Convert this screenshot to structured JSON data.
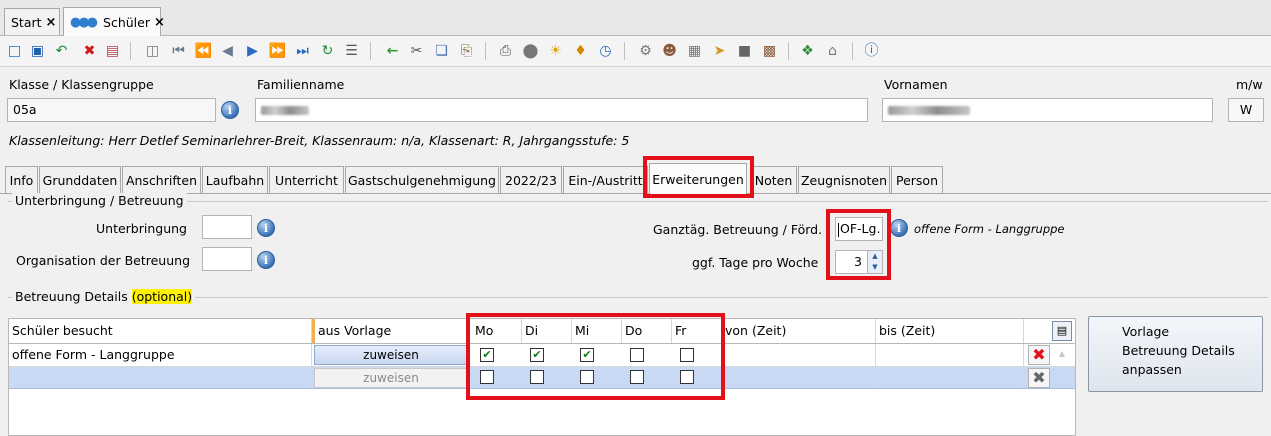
{
  "doc_tabs": [
    {
      "label": "Start",
      "close": "×"
    },
    {
      "label": "Schüler",
      "close": "×"
    }
  ],
  "toolbar_icons": [
    "new-icon",
    "save-icon",
    "undo-icon",
    "delete-icon",
    "cancel-icon",
    "copy-record-icon",
    "first-icon",
    "prev-page-icon",
    "prev-icon",
    "next-icon",
    "next-page-icon",
    "last-icon",
    "refresh-icon",
    "list-icon",
    "back-arrow-icon",
    "cut-icon",
    "copy-icon",
    "paste-icon",
    "print-icon",
    "preview-icon",
    "idea-icon",
    "bell-icon",
    "clock-icon",
    "tools-icon",
    "user-icon",
    "photo-icon",
    "folder-arrow-icon",
    "box-icon",
    "film-icon",
    "money-icon",
    "home-icon",
    "help-icon"
  ],
  "header": {
    "klasse_label": "Klasse / Klassengruppe",
    "klasse_value": "05a",
    "familienname_label": "Familienname",
    "vornamen_label": "Vornamen",
    "mw_label": "m/w",
    "mw_value": "W",
    "klassenleitung": "Klassenleitung: Herr Detlef Seminarlehrer-Breit, Klassenraum: n/a, Klassenart: R, Jahrgangsstufe: 5"
  },
  "tabs": [
    "Info",
    "Grunddaten",
    "Anschriften",
    "Laufbahn",
    "Unterricht",
    "Gastschulgenehmigung",
    "2022/23",
    "Ein-/Austritt",
    "Erweiterungen",
    "Noten",
    "Zeugnisnoten",
    "Person"
  ],
  "active_tab": "Erweiterungen",
  "unterbringung": {
    "title": "Unterbringung / Betreuung",
    "unterbringung_label": "Unterbringung",
    "organisation_label": "Organisation der Betreuung",
    "ganztag_label": "Ganztäg. Betreuung / Förd.",
    "ganztag_value": "OF-Lg.",
    "ganztag_desc": "offene Form - Langgruppe",
    "tage_label": "ggf. Tage pro Woche",
    "tage_value": "3"
  },
  "details": {
    "title": "Betreuung Details",
    "optional": "(optional)",
    "columns": [
      "Schüler besucht",
      "aus Vorlage",
      "Mo",
      "Di",
      "Mi",
      "Do",
      "Fr",
      "von (Zeit)",
      "bis (Zeit)"
    ],
    "rows": [
      {
        "besucht": "offene Form - Langgruppe",
        "button": "zuweisen",
        "days": [
          true,
          true,
          true,
          false,
          false
        ],
        "von": "",
        "bis": ""
      },
      {
        "besucht": "",
        "button": "zuweisen",
        "days": [
          false,
          false,
          false,
          false,
          false
        ],
        "von": "",
        "bis": ""
      }
    ],
    "vorlage_button": [
      "Vorlage",
      "Betreuung Details",
      "anpassen"
    ]
  },
  "colors": {
    "highlight_red": "#e3101a",
    "optional_yellow": "#fff200",
    "selected_row": "#c9d9f3"
  }
}
